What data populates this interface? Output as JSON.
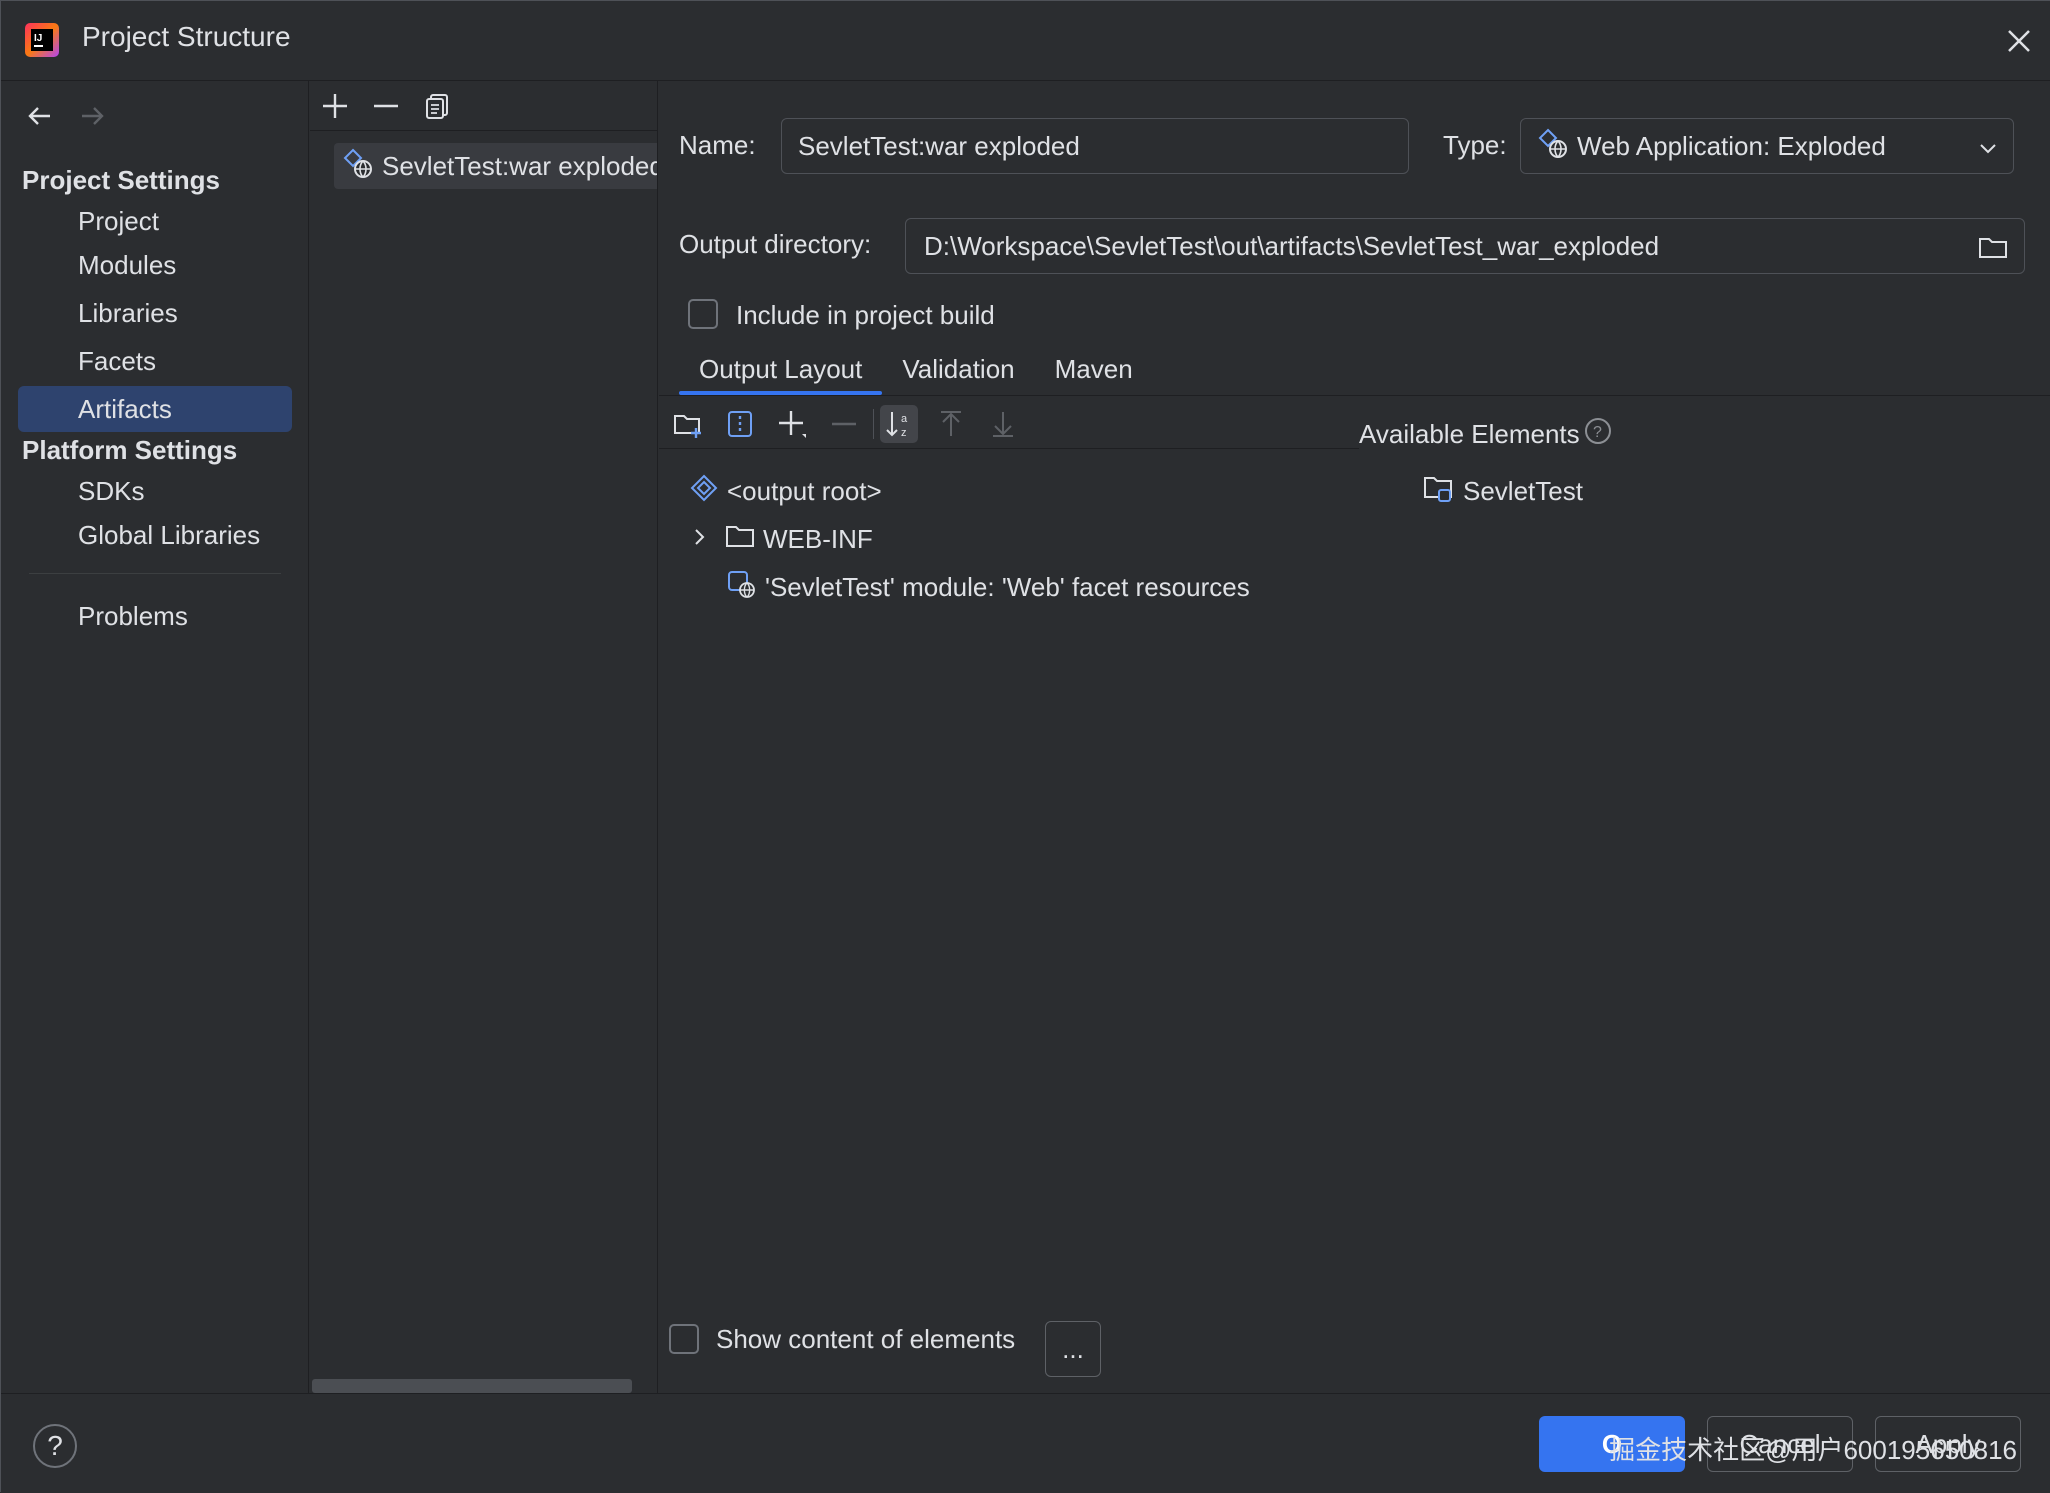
{
  "window": {
    "title": "Project Structure"
  },
  "sidebar": {
    "project_settings_title": "Project Settings",
    "project_items": [
      {
        "label": "Project"
      },
      {
        "label": "Modules"
      },
      {
        "label": "Libraries"
      },
      {
        "label": "Facets"
      },
      {
        "label": "Artifacts",
        "selected": true
      }
    ],
    "platform_settings_title": "Platform Settings",
    "platform_items": [
      {
        "label": "SDKs"
      },
      {
        "label": "Global Libraries"
      }
    ],
    "problems_label": "Problems"
  },
  "artifacts": {
    "items": [
      {
        "label": "SevletTest:war exploded"
      }
    ]
  },
  "details": {
    "name_label": "Name:",
    "name_value": "SevletTest:war exploded",
    "type_label": "Type:",
    "type_value": "Web Application: Exploded",
    "output_dir_label": "Output directory:",
    "output_dir_value": "D:\\Workspace\\SevletTest\\out\\artifacts\\SevletTest_war_exploded",
    "include_build_label": "Include in project build",
    "include_build_checked": false,
    "tabs": [
      {
        "label": "Output Layout",
        "active": true
      },
      {
        "label": "Validation"
      },
      {
        "label": "Maven"
      }
    ],
    "available_elements_label": "Available Elements",
    "layout_tree": [
      {
        "label": "<output root>"
      },
      {
        "label": "WEB-INF"
      },
      {
        "label": "'SevletTest' module: 'Web' facet resources"
      }
    ],
    "available_tree": [
      {
        "label": "SevletTest"
      }
    ],
    "show_content_label": "Show content of elements",
    "ellipsis_label": "..."
  },
  "footer": {
    "help_label": "?",
    "ok_label": "O",
    "cancel_label": "Cancel",
    "apply_label": "Apply",
    "watermark": "掘金技术社区@用户600195650816"
  },
  "colors": {
    "background": "#2b2d30",
    "selection": "#2e436e",
    "accent": "#3574f0",
    "text": "#dfe1e5"
  }
}
